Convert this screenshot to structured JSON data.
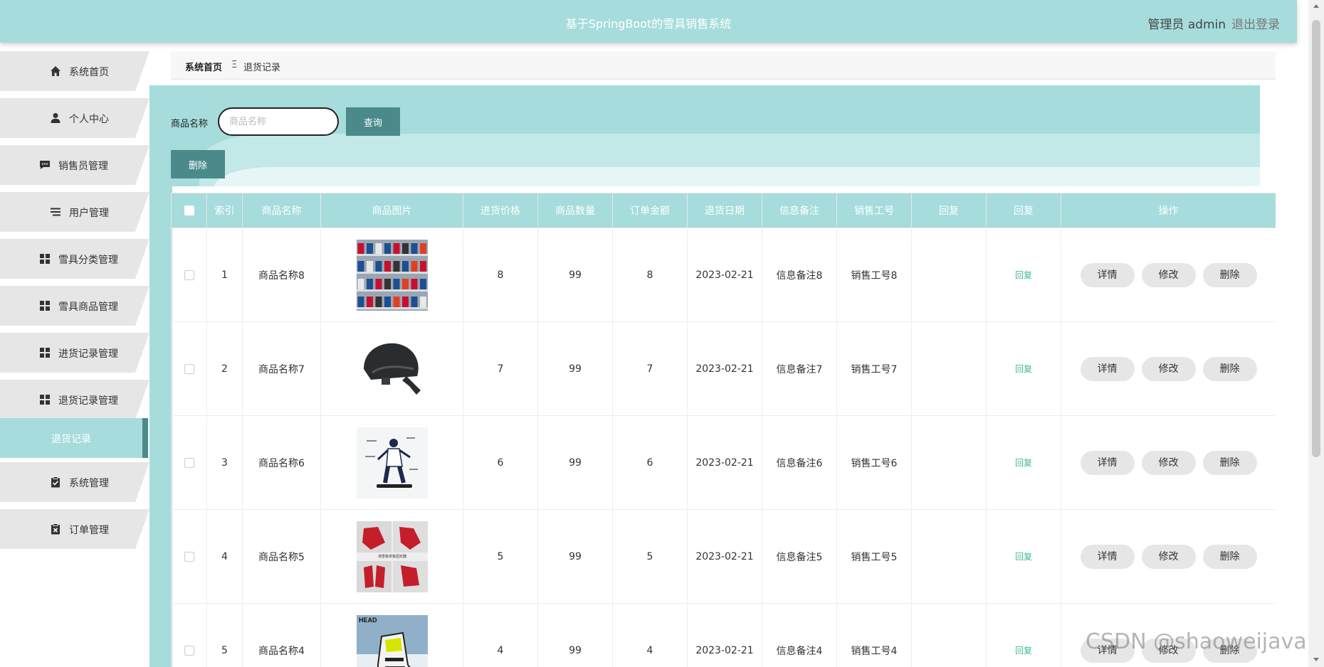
{
  "header": {
    "title": "基于SpringBoot的雪具销售系统",
    "user": "管理员 admin",
    "logout": "退出登录"
  },
  "sidebar": {
    "items": [
      {
        "label": "系统首页",
        "icon": "home-icon"
      },
      {
        "label": "个人中心",
        "icon": "user-icon"
      },
      {
        "label": "销售员管理",
        "icon": "chat-icon"
      },
      {
        "label": "用户管理",
        "icon": "list-icon"
      },
      {
        "label": "雪具分类管理",
        "icon": "grid-icon"
      },
      {
        "label": "雪具商品管理",
        "icon": "grid-icon"
      },
      {
        "label": "进货记录管理",
        "icon": "grid-icon"
      },
      {
        "label": "退货记录管理",
        "icon": "grid-icon"
      },
      {
        "label": "退货记录",
        "icon": ""
      },
      {
        "label": "系统管理",
        "icon": "clipboard-check-icon"
      },
      {
        "label": "订单管理",
        "icon": "clipboard-x-icon"
      }
    ]
  },
  "breadcrumb": {
    "home": "系统首页",
    "separator": "Ξ",
    "current": "退货记录"
  },
  "search": {
    "label": "商品名称",
    "placeholder": "商品名称",
    "query_button": "查询",
    "delete_button": "删除"
  },
  "table": {
    "headers": [
      "索引",
      "商品名称",
      "商品图片",
      "进货价格",
      "商品数量",
      "订单金额",
      "退货日期",
      "信息备注",
      "销售工号",
      "回复",
      "回复",
      "操作"
    ],
    "rows": [
      {
        "index": "1",
        "name": "商品名称8",
        "image": "ski-boots-rack-photo",
        "price": "8",
        "qty": "99",
        "amount": "8",
        "date": "2023-02-21",
        "note": "信息备注8",
        "staff": "销售工号8",
        "reply_text": "",
        "reply_link": "回复"
      },
      {
        "index": "2",
        "name": "商品名称7",
        "image": "ski-helmet-photo",
        "price": "7",
        "qty": "99",
        "amount": "7",
        "date": "2023-02-21",
        "note": "信息备注7",
        "staff": "销售工号7",
        "reply_text": "",
        "reply_link": "回复"
      },
      {
        "index": "3",
        "name": "商品名称6",
        "image": "snowboarder-figure-photo",
        "price": "6",
        "qty": "99",
        "amount": "6",
        "date": "2023-02-21",
        "note": "信息备注6",
        "staff": "销售工号6",
        "reply_text": "",
        "reply_link": "回复"
      },
      {
        "index": "4",
        "name": "商品名称5",
        "image": "snowboard-bindings-photo",
        "price": "5",
        "qty": "99",
        "amount": "5",
        "date": "2023-02-21",
        "note": "信息备注5",
        "staff": "销售工号5",
        "reply_text": "",
        "reply_link": "回复"
      },
      {
        "index": "5",
        "name": "商品名称4",
        "image": "head-ski-boot-photo",
        "price": "4",
        "qty": "99",
        "amount": "4",
        "date": "2023-02-21",
        "note": "信息备注4",
        "staff": "销售工号4",
        "reply_text": "",
        "reply_link": "回复"
      }
    ],
    "actions": {
      "detail": "详情",
      "edit": "修改",
      "delete": "删除"
    },
    "binding_caption": "滑雪板单板固定器",
    "brand_text": "HEAD"
  },
  "watermark": "CSDN @shaoweijava",
  "colors": {
    "accent": "#a6dcdc",
    "button": "#4a8a8a",
    "reply": "#3cc089"
  }
}
